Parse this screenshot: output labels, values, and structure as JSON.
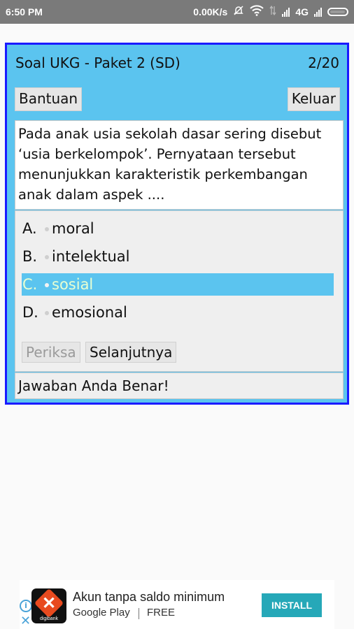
{
  "status_bar": {
    "time": "6:50 PM",
    "speed": "0.00K/s",
    "network": "4G",
    "icons": [
      "mute-icon",
      "wifi-icon",
      "data-arrows-icon",
      "signal-icon",
      "signal-icon",
      "battery-icon"
    ]
  },
  "quiz": {
    "title": "Soal UKG - Paket 2 (SD)",
    "counter": "2/20",
    "help_label": "Bantuan",
    "exit_label": "Keluar",
    "question": "Pada anak usia sekolah dasar sering disebut ‘usia berkelompok’. Pernyataan tersebut menunjukkan karakteristik perkembangan anak dalam aspek ....",
    "options": [
      {
        "letter": "A.",
        "text": "moral"
      },
      {
        "letter": "B.",
        "text": "intelektual"
      },
      {
        "letter": "C.",
        "text": "sosial"
      },
      {
        "letter": "D.",
        "text": "emosional"
      }
    ],
    "selected_option": "C.",
    "check_label": "Periksa",
    "next_label": "Selanjutnya",
    "feedback": "Jawaban Anda Benar!"
  },
  "ad": {
    "brand_tag": "digibank",
    "title": "Akun tanpa saldo minimum",
    "store": "Google Play",
    "price": "FREE",
    "install_label": "INSTALL"
  },
  "colors": {
    "frame_border": "#1a1aff",
    "panel": "#5bc4ef",
    "selected_text": "#e9ffd2",
    "install": "#26a8b8"
  }
}
